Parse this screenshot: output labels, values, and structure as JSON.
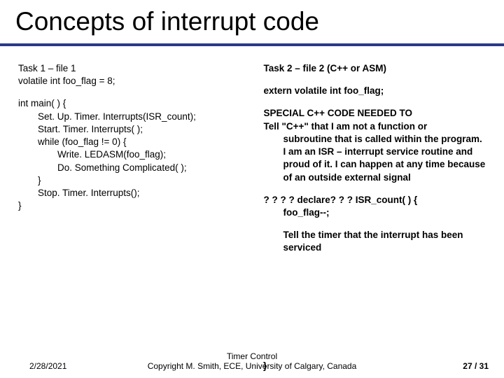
{
  "title": "Concepts of interrupt code",
  "left": {
    "task_header": "Task 1 – file 1",
    "volatile_decl": "volatile int foo_flag = 8;",
    "main_open": "int main( ) {",
    "setup": "Set. Up. Timer. Interrupts(ISR_count);",
    "start": "Start. Timer. Interrupts( );",
    "while": "while (foo_flag != 0) {",
    "write": "Write. LEDASM(foo_flag);",
    "dosth": "Do. Something Complicated( );",
    "while_close": "}",
    "stop": "Stop. Timer. Interrupts();",
    "main_close": "}"
  },
  "right": {
    "task_header": "Task 2 – file 2  (C++ or ASM)",
    "extern": "extern volatile int foo_flag;",
    "special": "SPECIAL C++ CODE NEEDED TO",
    "tell": "Tell \"C++\" that I am not a function or subroutine that is called within the program. I am an ISR – interrupt service routine  and proud of it. I can happen at any time because of an outside external signal",
    "declare": "? ? ? ? declare? ? ? ISR_count( ) {",
    "foo_dec": "foo_flag--;",
    "tell_timer": "Tell the timer that the interrupt has been serviced",
    "close": "}"
  },
  "footer": {
    "date": "2/28/2021",
    "center1": "Timer Control",
    "center2": "Copyright M. Smith, ECE, University of Calgary, Canada",
    "page": "27 /  31"
  }
}
